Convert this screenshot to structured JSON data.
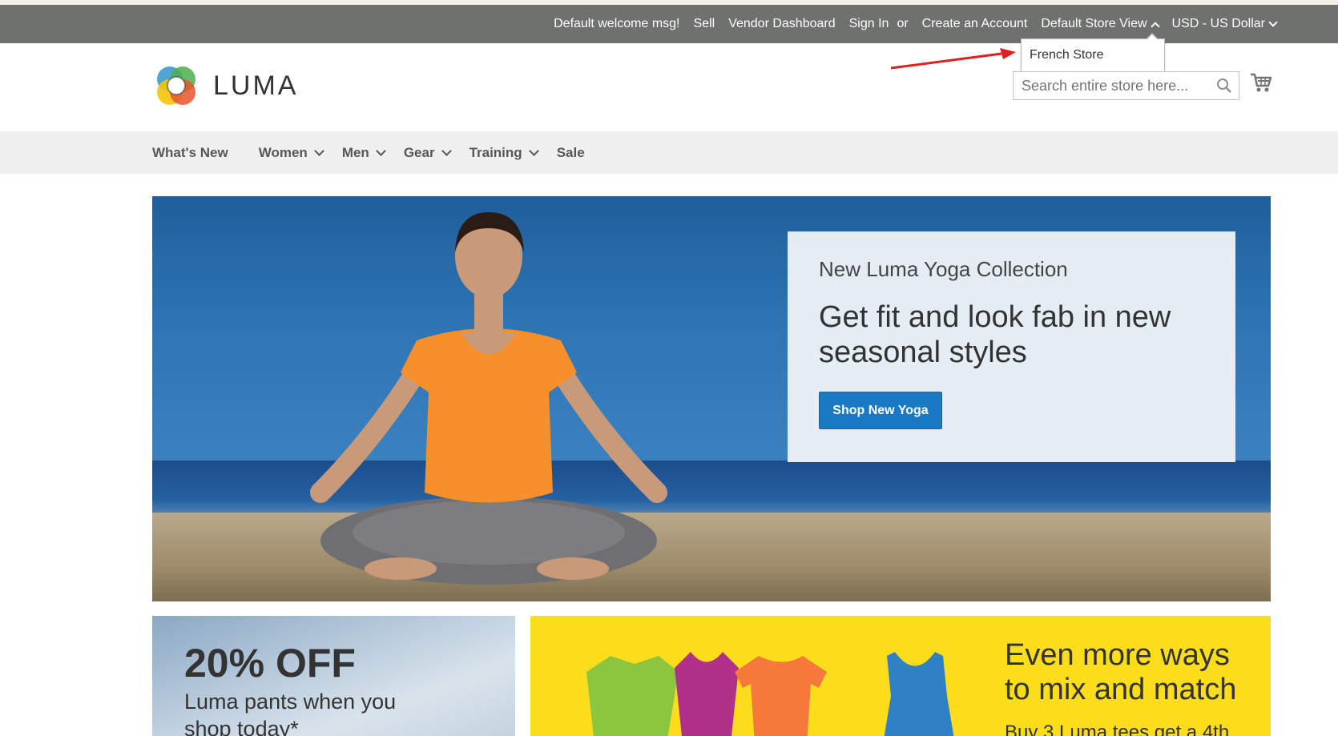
{
  "header": {
    "links": {
      "welcome": "Default welcome msg!",
      "sell": "Sell",
      "vendor_dashboard": "Vendor Dashboard",
      "sign_in": "Sign In",
      "or": "or",
      "create_account": "Create an Account"
    },
    "store_switcher": {
      "selected": "Default Store View",
      "expanded": true,
      "options": [
        "French Store"
      ]
    },
    "currency_switcher": {
      "selected": "USD - US Dollar"
    }
  },
  "logo": {
    "text": "LUMA"
  },
  "search": {
    "placeholder": "Search entire store here..."
  },
  "nav": {
    "items": [
      {
        "label": "What's New",
        "has_submenu": false
      },
      {
        "label": "Women",
        "has_submenu": true
      },
      {
        "label": "Men",
        "has_submenu": true
      },
      {
        "label": "Gear",
        "has_submenu": true
      },
      {
        "label": "Training",
        "has_submenu": true
      },
      {
        "label": "Sale",
        "has_submenu": false
      }
    ]
  },
  "hero": {
    "kicker": "New Luma Yoga Collection",
    "headline": "Get fit and look fab in new seasonal styles",
    "cta": "Shop New Yoga"
  },
  "promo_left": {
    "big": "20% OFF",
    "sub": "Luma pants when you shop today*"
  },
  "promo_right": {
    "title": "Even more ways to mix and match",
    "sub": "Buy 3 Luma tees get a 4th"
  },
  "colors": {
    "header_bar": "#6e716e",
    "nav_bg": "#f0f0f0",
    "cta_blue": "#1979c3",
    "promo_yellow": "#fbdd1c",
    "annotation_arrow": "#e02020"
  }
}
